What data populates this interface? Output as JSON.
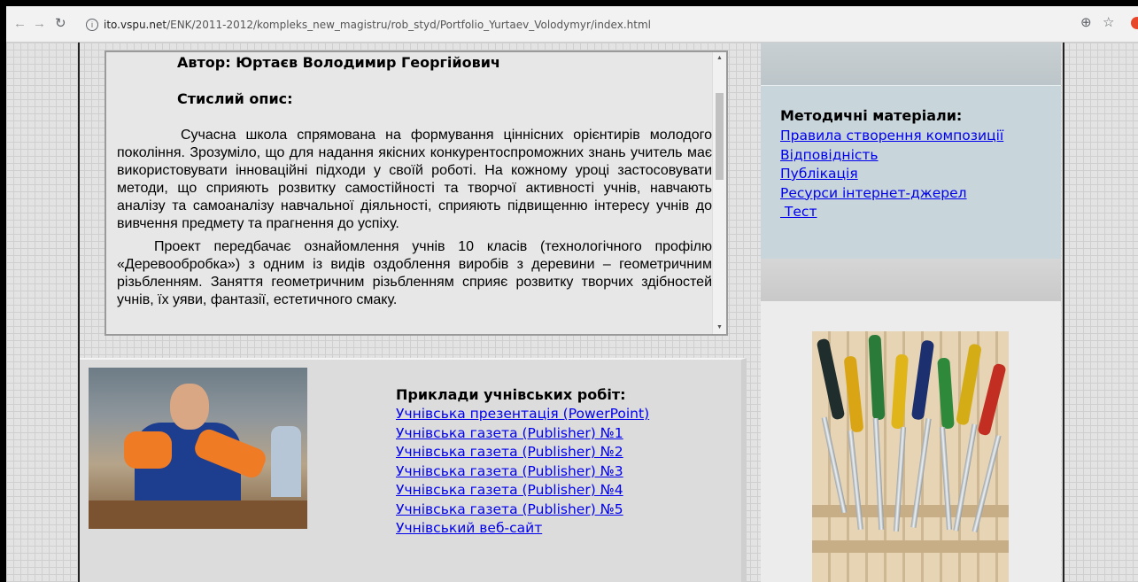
{
  "browser": {
    "url_host": "ito.vspu.net",
    "url_path": "/ENK/2011-2012/kompleks_new_magistru/rob_styd/Portfolio_Yurtaev_Volodymyr/index.html",
    "info_glyph": "i",
    "icons": [
      "back-arrow-icon",
      "forward-arrow-icon",
      "reload-icon",
      "info-icon",
      "zoom-icon",
      "star-icon",
      "extension-icon"
    ]
  },
  "description": {
    "author": "Автор: Юртаєв Володимир Георгійович",
    "heading": "Стислий опис:",
    "paragraph1": "Сучасна школа спрямована на формування ціннісних орієнтирів молодого покоління. Зрозуміло, що для надання якісних конкурентоспроможних знань учитель має використовувати інноваційні підходи у своїй роботі. На кожному уроці застосовувати методи, що сприяють розвитку самостійності та творчої активності учнів, навчають аналізу та самоаналізу навчальної діяльності, сприяють підвищенню інтересу учнів до вивчення предмету та прагнення до успіху.",
    "paragraph2": "Проект передбачає ознайомлення учнів 10 класів (технологічного профілю «Деревообробка») з одним із видів оздоблення виробів з деревини – геометричним різьбленням. Заняття геометричним різьбленням сприяє розвитку творчих здібностей учнів, їх уяви, фантазії, естетичного смаку."
  },
  "examples": {
    "title": "Приклади учнівських робіт:",
    "links": [
      "Учнівська презентація (PowerPoint)",
      "Учнівська газета (Publisher) №1",
      "Учнівська газета (Publisher) №2",
      "Учнівська газета (Publisher) №3",
      "Учнівська газета (Publisher) №4",
      "Учнівська газета (Publisher) №5",
      "Учнівський веб-сайт"
    ]
  },
  "methods": {
    "title": "Методичні матеріали:",
    "links": [
      "Правила створення композиції",
      "Відповідність",
      "Публікація",
      "Ресурси інтернет-джерел",
      " Тест"
    ]
  }
}
